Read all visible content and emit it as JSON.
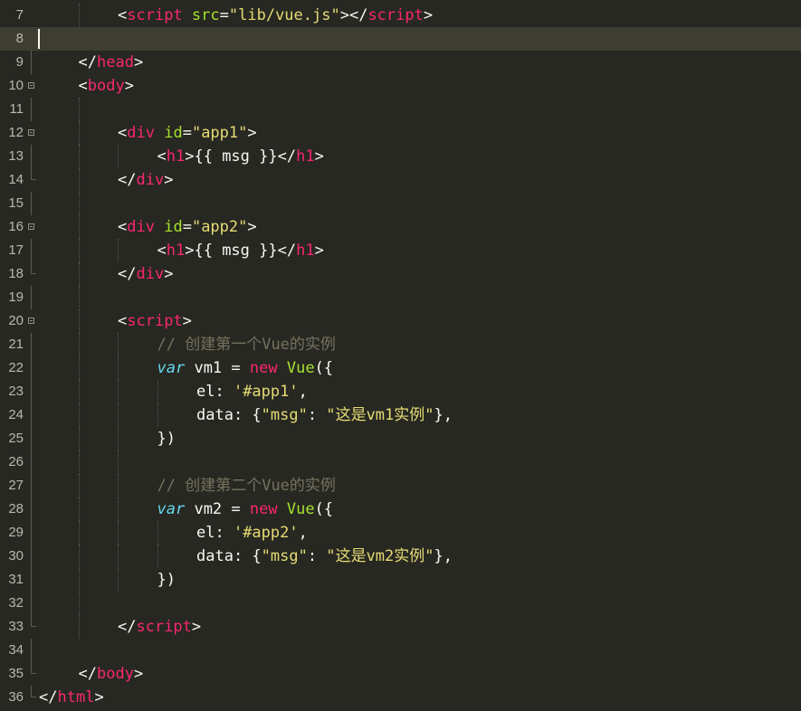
{
  "editor": {
    "active_line": "8",
    "lines": [
      {
        "num": "7",
        "fold": "none",
        "indent": 2,
        "tokens": [
          [
            "t-punct",
            "<"
          ],
          [
            "t-tag",
            "script"
          ],
          [
            "t-plain",
            " "
          ],
          [
            "t-attr",
            "src"
          ],
          [
            "t-punct",
            "="
          ],
          [
            "t-str",
            "\"lib/vue.js\""
          ],
          [
            "t-punct",
            "></"
          ],
          [
            "t-tag",
            "script"
          ],
          [
            "t-punct",
            ">"
          ]
        ]
      },
      {
        "num": "8",
        "fold": "none",
        "indent": 0,
        "tokens": []
      },
      {
        "num": "9",
        "fold": "none",
        "indent": 1,
        "tokens": [
          [
            "t-punct",
            "</"
          ],
          [
            "t-tag",
            "head"
          ],
          [
            "t-punct",
            ">"
          ]
        ]
      },
      {
        "num": "10",
        "fold": "open",
        "indent": 1,
        "tokens": [
          [
            "t-punct",
            "<"
          ],
          [
            "t-tag",
            "body"
          ],
          [
            "t-punct",
            ">"
          ]
        ]
      },
      {
        "num": "11",
        "fold": "line",
        "indent": 0,
        "tokens": []
      },
      {
        "num": "12",
        "fold": "open",
        "indent": 2,
        "tokens": [
          [
            "t-punct",
            "<"
          ],
          [
            "t-tag",
            "div"
          ],
          [
            "t-plain",
            " "
          ],
          [
            "t-attr",
            "id"
          ],
          [
            "t-punct",
            "="
          ],
          [
            "t-str",
            "\"app1\""
          ],
          [
            "t-punct",
            ">"
          ]
        ]
      },
      {
        "num": "13",
        "fold": "line",
        "indent": 3,
        "tokens": [
          [
            "t-punct",
            "<"
          ],
          [
            "t-tag",
            "h1"
          ],
          [
            "t-punct",
            ">"
          ],
          [
            "t-plain",
            "{{ msg }}"
          ],
          [
            "t-punct",
            "</"
          ],
          [
            "t-tag",
            "h1"
          ],
          [
            "t-punct",
            ">"
          ]
        ]
      },
      {
        "num": "14",
        "fold": "end",
        "indent": 2,
        "tokens": [
          [
            "t-punct",
            "</"
          ],
          [
            "t-tag",
            "div"
          ],
          [
            "t-punct",
            ">"
          ]
        ]
      },
      {
        "num": "15",
        "fold": "line",
        "indent": 0,
        "tokens": []
      },
      {
        "num": "16",
        "fold": "open",
        "indent": 2,
        "tokens": [
          [
            "t-punct",
            "<"
          ],
          [
            "t-tag",
            "div"
          ],
          [
            "t-plain",
            " "
          ],
          [
            "t-attr",
            "id"
          ],
          [
            "t-punct",
            "="
          ],
          [
            "t-str",
            "\"app2\""
          ],
          [
            "t-punct",
            ">"
          ]
        ]
      },
      {
        "num": "17",
        "fold": "line",
        "indent": 3,
        "tokens": [
          [
            "t-punct",
            "<"
          ],
          [
            "t-tag",
            "h1"
          ],
          [
            "t-punct",
            ">"
          ],
          [
            "t-plain",
            "{{ msg }}"
          ],
          [
            "t-punct",
            "</"
          ],
          [
            "t-tag",
            "h1"
          ],
          [
            "t-punct",
            ">"
          ]
        ]
      },
      {
        "num": "18",
        "fold": "end",
        "indent": 2,
        "tokens": [
          [
            "t-punct",
            "</"
          ],
          [
            "t-tag",
            "div"
          ],
          [
            "t-punct",
            ">"
          ]
        ]
      },
      {
        "num": "19",
        "fold": "line",
        "indent": 0,
        "tokens": []
      },
      {
        "num": "20",
        "fold": "open",
        "indent": 2,
        "tokens": [
          [
            "t-punct",
            "<"
          ],
          [
            "t-tag",
            "script"
          ],
          [
            "t-punct",
            ">"
          ]
        ]
      },
      {
        "num": "21",
        "fold": "line",
        "indent": 3,
        "tokens": [
          [
            "t-comment",
            "// 创建第一个Vue的实例"
          ]
        ]
      },
      {
        "num": "22",
        "fold": "line",
        "indent": 3,
        "tokens": [
          [
            "t-kw",
            "var"
          ],
          [
            "t-plain",
            " vm1 = "
          ],
          [
            "t-new",
            "new"
          ],
          [
            "t-plain",
            " "
          ],
          [
            "t-fn",
            "Vue"
          ],
          [
            "t-plain",
            "({"
          ]
        ]
      },
      {
        "num": "23",
        "fold": "line",
        "indent": 4,
        "tokens": [
          [
            "t-plain",
            "el: "
          ],
          [
            "t-str",
            "'#app1'"
          ],
          [
            "t-plain",
            ","
          ]
        ]
      },
      {
        "num": "24",
        "fold": "line",
        "indent": 4,
        "tokens": [
          [
            "t-plain",
            "data: {"
          ],
          [
            "t-str",
            "\"msg\""
          ],
          [
            "t-plain",
            ": "
          ],
          [
            "t-str",
            "\"这是vm1实例\""
          ],
          [
            "t-plain",
            "},"
          ]
        ]
      },
      {
        "num": "25",
        "fold": "line",
        "indent": 3,
        "tokens": [
          [
            "t-plain",
            "})"
          ]
        ]
      },
      {
        "num": "26",
        "fold": "line",
        "indent": 0,
        "tokens": []
      },
      {
        "num": "27",
        "fold": "line",
        "indent": 3,
        "tokens": [
          [
            "t-comment",
            "// 创建第二个Vue的实例"
          ]
        ]
      },
      {
        "num": "28",
        "fold": "line",
        "indent": 3,
        "tokens": [
          [
            "t-kw",
            "var"
          ],
          [
            "t-plain",
            " vm2 = "
          ],
          [
            "t-new",
            "new"
          ],
          [
            "t-plain",
            " "
          ],
          [
            "t-fn",
            "Vue"
          ],
          [
            "t-plain",
            "({"
          ]
        ]
      },
      {
        "num": "29",
        "fold": "line",
        "indent": 4,
        "tokens": [
          [
            "t-plain",
            "el: "
          ],
          [
            "t-str",
            "'#app2'"
          ],
          [
            "t-plain",
            ","
          ]
        ]
      },
      {
        "num": "30",
        "fold": "line",
        "indent": 4,
        "tokens": [
          [
            "t-plain",
            "data: {"
          ],
          [
            "t-str",
            "\"msg\""
          ],
          [
            "t-plain",
            ": "
          ],
          [
            "t-str",
            "\"这是vm2实例\""
          ],
          [
            "t-plain",
            "},"
          ]
        ]
      },
      {
        "num": "31",
        "fold": "line",
        "indent": 3,
        "tokens": [
          [
            "t-plain",
            "})"
          ]
        ]
      },
      {
        "num": "32",
        "fold": "line",
        "indent": 0,
        "tokens": []
      },
      {
        "num": "33",
        "fold": "end",
        "indent": 2,
        "tokens": [
          [
            "t-punct",
            "</"
          ],
          [
            "t-tag",
            "script"
          ],
          [
            "t-punct",
            ">"
          ]
        ]
      },
      {
        "num": "34",
        "fold": "line",
        "indent": 0,
        "tokens": []
      },
      {
        "num": "35",
        "fold": "end",
        "indent": 1,
        "tokens": [
          [
            "t-punct",
            "</"
          ],
          [
            "t-tag",
            "body"
          ],
          [
            "t-punct",
            ">"
          ]
        ]
      },
      {
        "num": "36",
        "fold": "end",
        "indent": 0,
        "tokens": [
          [
            "t-punct",
            "</"
          ],
          [
            "t-tag",
            "html"
          ],
          [
            "t-punct",
            ">"
          ]
        ]
      }
    ],
    "colors": {
      "background": "#272822",
      "active_line": "#3E3D32",
      "tag": "#F92672",
      "attribute": "#A6E22E",
      "string": "#E6DB74",
      "comment": "#75715E",
      "keyword": "#66D9EF",
      "text": "#F8F8F2",
      "gutter_text": "#B8B8B0"
    }
  }
}
